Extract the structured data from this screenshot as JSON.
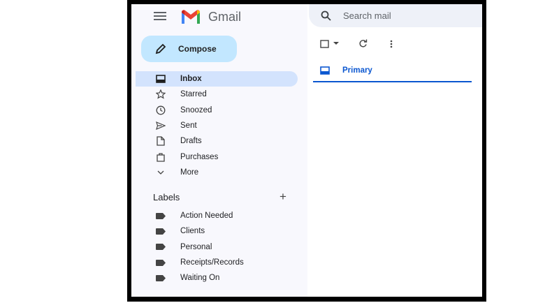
{
  "header": {
    "brand": "Gmail",
    "search_placeholder": "Search mail"
  },
  "compose": {
    "label": "Compose"
  },
  "nav": [
    {
      "label": "Inbox",
      "icon": "inbox-icon",
      "active": true
    },
    {
      "label": "Starred",
      "icon": "star-icon"
    },
    {
      "label": "Snoozed",
      "icon": "clock-icon"
    },
    {
      "label": "Sent",
      "icon": "send-icon"
    },
    {
      "label": "Drafts",
      "icon": "draft-icon"
    },
    {
      "label": "Purchases",
      "icon": "bag-icon"
    },
    {
      "label": "More",
      "icon": "chevron-down-icon"
    }
  ],
  "labels": {
    "title": "Labels",
    "items": [
      "Action Needed",
      "Clients",
      "Personal",
      "Receipts/Records",
      "Waiting On"
    ]
  },
  "tabs": [
    {
      "label": "Primary",
      "active": true
    }
  ],
  "colors": {
    "accent": "#0b57d0",
    "compose": "#c2e7ff",
    "active_nav": "#d3e3fd"
  }
}
